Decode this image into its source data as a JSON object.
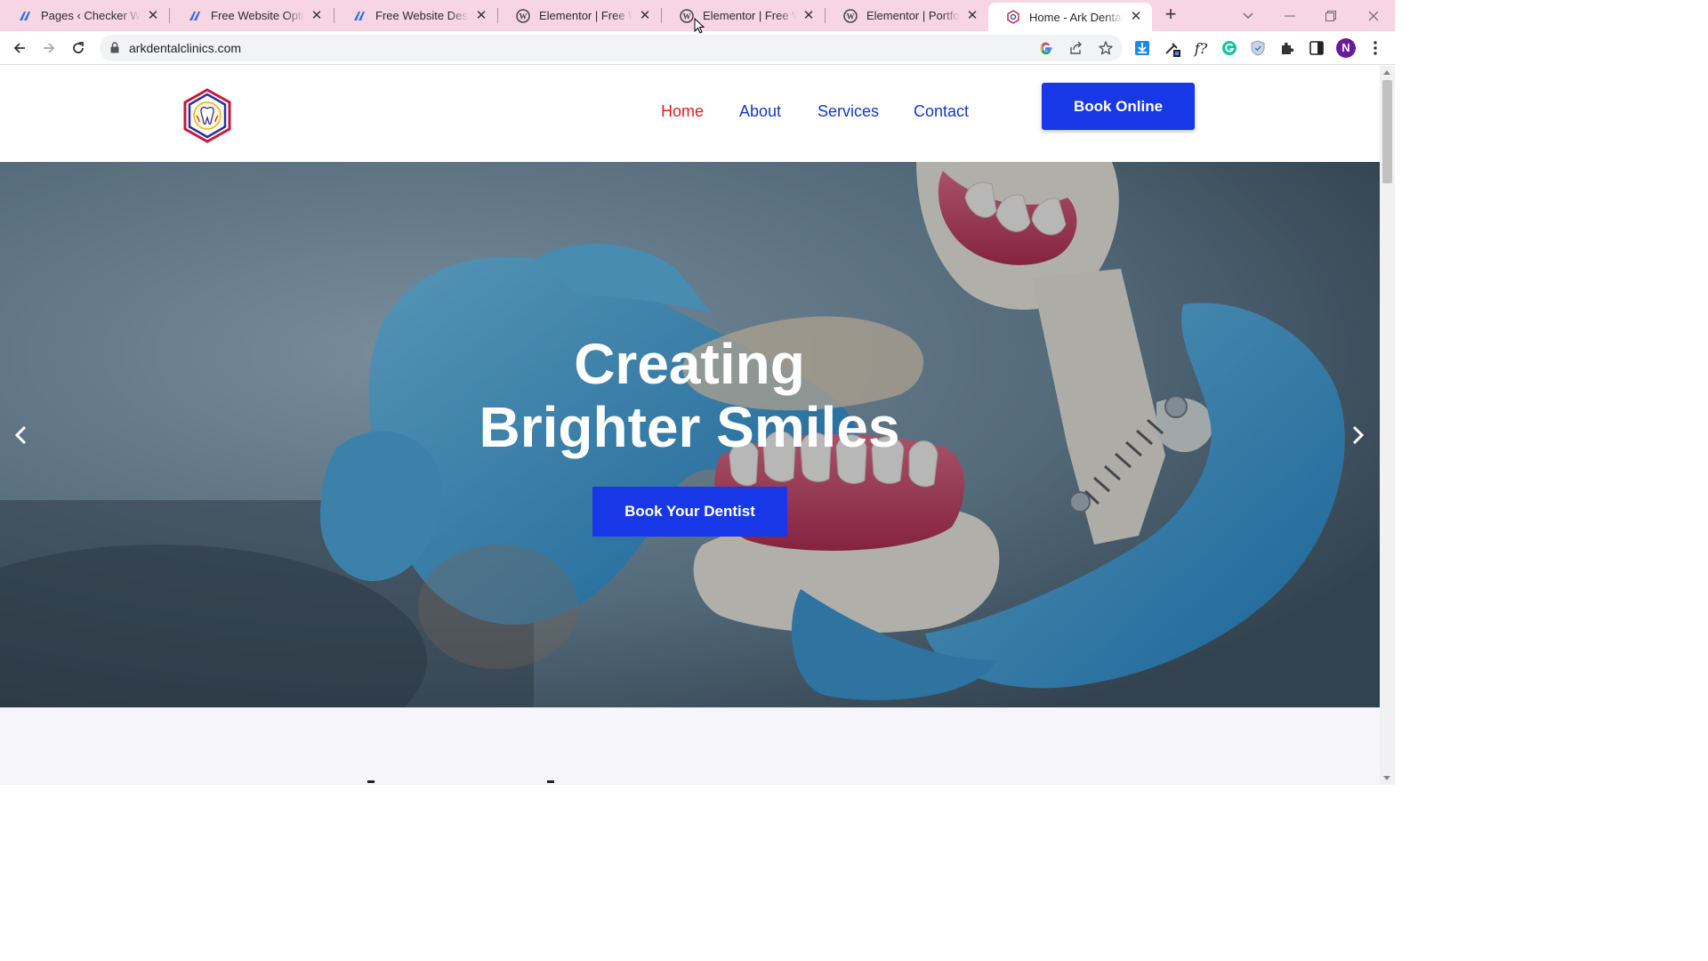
{
  "browser": {
    "tabs": [
      {
        "title": "Pages ‹ Checker Website",
        "favicon": "jetpack-like-icon"
      },
      {
        "title": "Free Website Optin – Checker",
        "favicon": "jetpack-like-icon"
      },
      {
        "title": "Free Website Design – Checker",
        "favicon": "jetpack-like-icon"
      },
      {
        "title": "Elementor | Free Website",
        "favicon": "wordpress-icon"
      },
      {
        "title": "Elementor | Free Website",
        "favicon": "wordpress-icon"
      },
      {
        "title": "Elementor | Portfolio",
        "favicon": "wordpress-icon"
      },
      {
        "title": "Home - Ark Dental Clinics",
        "favicon": "ark-dental-icon",
        "active": true
      }
    ],
    "url": "arkdentalclinics.com",
    "profile_initial": "N",
    "accent": "#f8d5e3"
  },
  "site": {
    "logo_alt": "Ark Dental Clinic",
    "nav": [
      {
        "label": "Home",
        "active": true
      },
      {
        "label": "About"
      },
      {
        "label": "Services"
      },
      {
        "label": "Contact"
      }
    ],
    "book_online_label": "Book Online",
    "hero": {
      "line1": "Creating",
      "line2": "Brighter Smiles",
      "button_label": "Book Your Dentist"
    },
    "colors": {
      "primary": "#1837e6",
      "nav": "#1438c6",
      "nav_active": "#e01e1e"
    }
  }
}
